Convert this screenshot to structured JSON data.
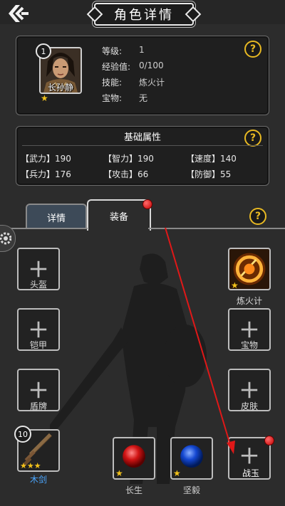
{
  "header": {
    "title": "角色详情",
    "back_icon": "back-arrow-icon"
  },
  "hero": {
    "level_badge": "1",
    "name": "长孙静",
    "stars": "★",
    "stats": [
      {
        "label": "等级:",
        "value": "1"
      },
      {
        "label": "经验值:",
        "value": "0/100"
      },
      {
        "label": "技能:",
        "value": "炼火计"
      },
      {
        "label": "宝物:",
        "value": "无"
      }
    ]
  },
  "attributes": {
    "title": "基础属性",
    "cells": [
      "【武力】190",
      "【智力】190",
      "【速度】140",
      "【兵力】176",
      "【攻击】66",
      "【防御】55"
    ]
  },
  "tabs": [
    {
      "label": "详情",
      "active": false
    },
    {
      "label": "装备",
      "active": true,
      "has_notification": true
    }
  ],
  "help_icon": "?",
  "equipment": {
    "left_slots": [
      {
        "label": "头盔",
        "filled": false
      },
      {
        "label": "铠甲",
        "filled": false
      },
      {
        "label": "盾牌",
        "filled": false
      },
      {
        "label": "木剑",
        "filled": true,
        "level": "10",
        "stars": "★★★",
        "icon": "wooden-sword-icon"
      }
    ],
    "right_slots": [
      {
        "label": "炼火计",
        "filled": true,
        "stars": "★",
        "icon": "fire-skill-icon"
      },
      {
        "label": "宝物",
        "filled": false
      },
      {
        "label": "皮肤",
        "filled": false
      },
      {
        "label": "战玉",
        "filled": false,
        "has_notification": true
      }
    ],
    "bottom_slots": [
      {
        "label": "长生",
        "filled": true,
        "stars": "★",
        "icon": "red-orb-icon",
        "color": "#d11414"
      },
      {
        "label": "坚毅",
        "filled": true,
        "stars": "★",
        "icon": "blue-orb-icon",
        "color": "#1447d1"
      }
    ]
  },
  "colors": {
    "accent_gold": "#e8b923",
    "star": "#f3c21a",
    "blue_label": "#4ba7ff",
    "arrow": "#e01818"
  }
}
